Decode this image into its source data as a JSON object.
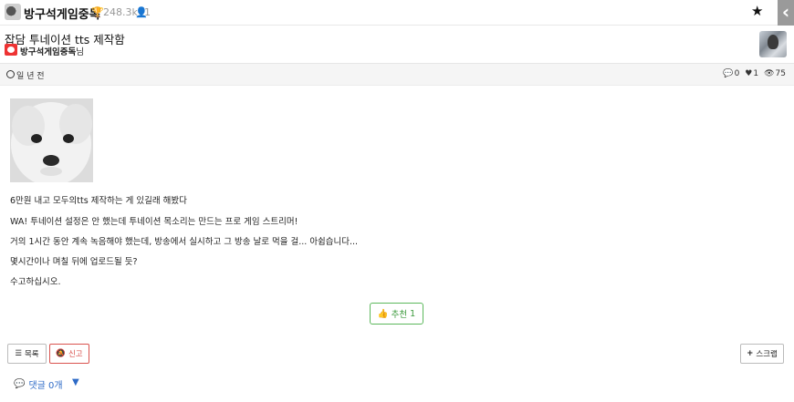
{
  "channel": {
    "name": "방구석게임중독",
    "subscribers": "248.3k",
    "members": "1"
  },
  "post": {
    "title": "잡담 투네이션 tts 제작함",
    "author": "방구석게임중독",
    "author_suffix": "님",
    "time": "일 년 전",
    "comments_count": "0",
    "likes_count": "1",
    "views_count": "75",
    "body": [
      "6만원 내고 모두의tts 제작하는 게 있길래 해봤다",
      "WA! 투네이션 설정은 안 했는데 투네이션 목소리는 만드는 프로 게임 스트리머!",
      "거의 1시간 동안 계속 녹음해야 했는데, 방송에서 실시하고 그 방송 날로 먹을 걸... 아쉽습니다...",
      "몇시간이나 며칠 뒤에 업로드될 듯?",
      "수고하십시오."
    ]
  },
  "actions": {
    "recommend_label": "추천",
    "recommend_count": "1",
    "list_label": "목록",
    "report_label": "신고",
    "scrap_label": "스크랩"
  },
  "comments": {
    "label": "댓글 0개"
  },
  "icons": {
    "trophy": "trophy-icon",
    "person": "person-icon",
    "star": "star-icon",
    "clock": "clock-icon",
    "comment": "comment-icon",
    "heart": "heart-icon",
    "eye": "eye-icon",
    "thumbs_up": "thumbs-up-icon",
    "list": "list-icon",
    "report": "bell-slash-icon",
    "plus": "plus-icon",
    "chevron": "chevron-left-icon",
    "triangle": "triangle-down-icon"
  },
  "colors": {
    "recommend": "#5cb85c",
    "report": "#d9534f",
    "comments_link": "#2e6bc7",
    "author_badge": "#ee3333"
  }
}
